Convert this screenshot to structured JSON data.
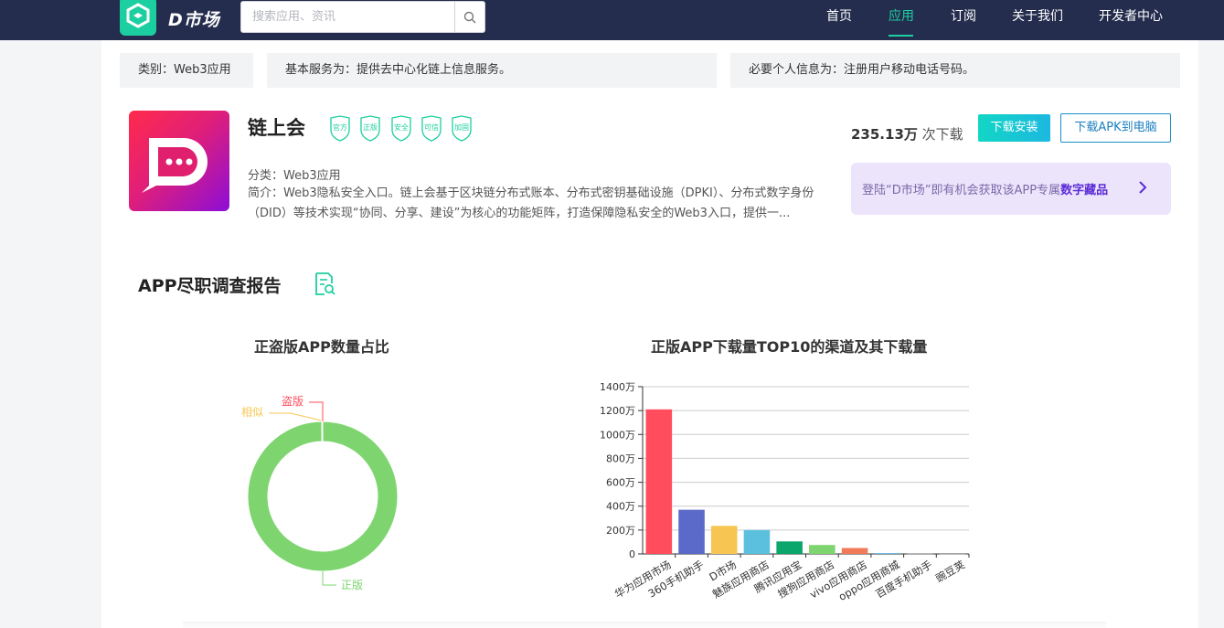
{
  "header": {
    "logo_text": "D市场",
    "search": {
      "placeholder": "搜索应用、资讯",
      "value": ""
    },
    "nav": [
      {
        "label": "首页",
        "active": false
      },
      {
        "label": "应用",
        "active": true
      },
      {
        "label": "订阅",
        "active": false
      },
      {
        "label": "关于我们",
        "active": false
      },
      {
        "label": "开发者中心",
        "active": false
      }
    ]
  },
  "info_bar": {
    "category": "类别：Web3应用",
    "basic_service": "基本服务为：提供去中心化链上信息服务。",
    "required_info": "必要个人信息为：注册用户移动电话号码。"
  },
  "app": {
    "name": "链上会",
    "badges": [
      "官方",
      "正版",
      "安全",
      "可信",
      "加固"
    ],
    "category_line": "分类：Web3应用",
    "description": "简介：Web3隐私安全入口。链上会基于区块链分布式账本、分布式密钥基础设施（DPKI）、分布式数字身份（DID）等技术实现“协同、分享、建设”为核心的功能矩阵，打造保障隐私安全的Web3入口，提供一...",
    "download_count": "235.13万",
    "download_suffix": " 次下载",
    "install_button": "下载安装",
    "apk_button": "下载APK到电脑",
    "promo_prefix": "登陆“D市场”即有机会获取该APP专属",
    "promo_highlight": "数字藏品"
  },
  "report": {
    "title": "APP尽职调查报告"
  },
  "colors": {
    "accent": "#1ccfa0",
    "nav_bg": "#242d4d",
    "promo_highlight": "#5b2bd6"
  },
  "chart_data": [
    {
      "type": "pie",
      "title": "正盗版APP数量占比",
      "donut": true,
      "slices": [
        {
          "label": "正版",
          "value": 99.8,
          "color": "#7ed56f"
        },
        {
          "label": "盗版",
          "value": 0.1,
          "color": "#ff4d5e"
        },
        {
          "label": "相似",
          "value": 0.1,
          "color": "#f7c652"
        }
      ]
    },
    {
      "type": "bar",
      "title": "正版APP下载量TOP10的渠道及其下载量",
      "categories": [
        "华为应用市场",
        "360手机助手",
        "D市场",
        "魅族应用商店",
        "腾讯应用宝",
        "搜狗应用商店",
        "vivo应用商店",
        "oppo应用商城",
        "百度手机助手",
        "豌豆荚"
      ],
      "values": [
        1210,
        370,
        235,
        200,
        105,
        75,
        50,
        5,
        2,
        1
      ],
      "colors": [
        "#ff4d5e",
        "#5b6ac9",
        "#f7c652",
        "#5bc0de",
        "#0aa66c",
        "#7ed56f",
        "#f07a5a",
        "#1e9ad6",
        "#999999",
        "#999999"
      ],
      "ylim": [
        0,
        1400
      ],
      "yticks": [
        "0",
        "200万",
        "400万",
        "600万",
        "800万",
        "1000万",
        "1200万",
        "1400万"
      ],
      "grid": true
    }
  ]
}
